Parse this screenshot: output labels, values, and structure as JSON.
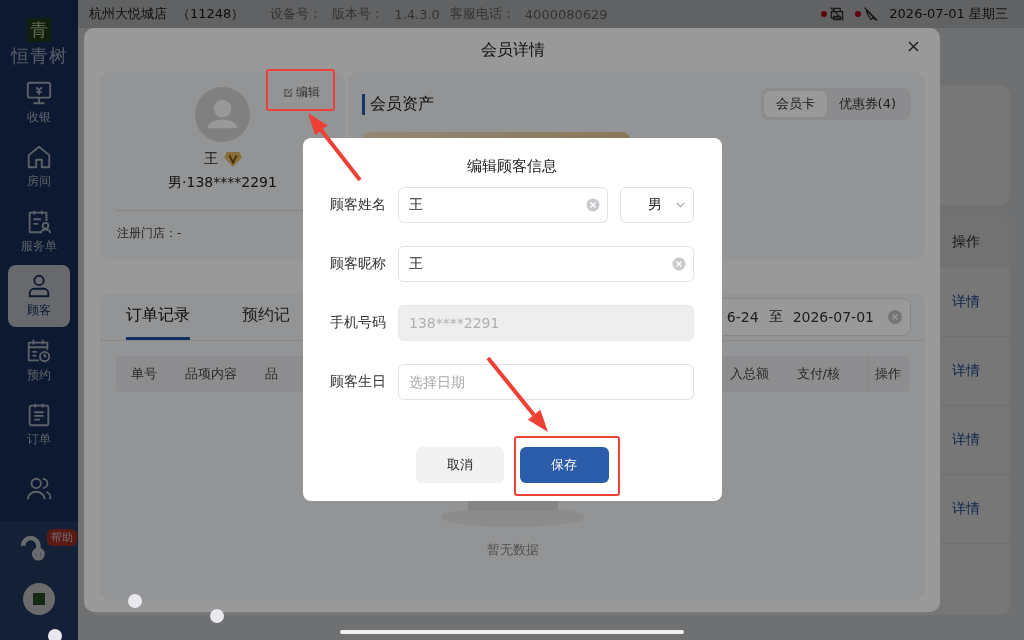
{
  "top_bar": {
    "store_name": "杭州大悦城店",
    "store_code": "（11248）",
    "device_label": "设备号：",
    "version_label": "版本号：",
    "version": "1.4.3.0",
    "service_label": "客服电话：",
    "service_phone": "4000080629",
    "status_icons": [
      {
        "kind": "printer",
        "alert": true
      },
      {
        "kind": "scanner",
        "alert": true
      }
    ],
    "date": "2026-07-01 星期三"
  },
  "sidebar": {
    "logo_mark": "青",
    "logo_text": "恒青树",
    "items": [
      {
        "label": "收银",
        "selected": false
      },
      {
        "label": "房间",
        "selected": false
      },
      {
        "label": "服务单",
        "selected": false
      },
      {
        "label": "顾客",
        "selected": true
      },
      {
        "label": "预约",
        "selected": false
      },
      {
        "label": "订单",
        "selected": false
      },
      {
        "selected": false
      }
    ],
    "help_badge": "帮助"
  },
  "background_list": {
    "header": "操作",
    "rows": [
      "详情",
      "详情",
      "详情",
      "详情"
    ]
  },
  "member_modal": {
    "title": "会员详情",
    "profile": {
      "edit_link": "编辑",
      "name": "王",
      "vip": true,
      "gender_phone": "男·138****2291",
      "store_label": "注册门店：-"
    },
    "assets": {
      "title": "会员资产",
      "tabs": [
        {
          "label": "会员卡",
          "selected": true
        },
        {
          "label": "优惠券(4)",
          "selected": false
        }
      ]
    },
    "records": {
      "tabs": [
        {
          "label": "订单记录",
          "selected": true
        },
        {
          "label": "预约记",
          "selected": false
        }
      ],
      "date_start": "6-24",
      "date_sep": "至",
      "date_end": "2026-07-01",
      "columns_left": [
        "单号",
        "品项内容",
        "品"
      ],
      "columns_right": [
        "入总额",
        "支付/核"
      ],
      "action_column": "操作",
      "empty_text": "暂无数据"
    }
  },
  "edit_dialog": {
    "title": "编辑顾客信息",
    "fields": [
      {
        "kind": "input",
        "label": "顾客姓名",
        "value": "王",
        "disabled": false,
        "select_value": "男"
      },
      {
        "kind": "input",
        "label": "顾客昵称",
        "value": "王",
        "disabled": false
      },
      {
        "kind": "input",
        "label": "手机号码",
        "value": "138****2291",
        "disabled": true
      },
      {
        "kind": "date",
        "label": "顾客生日",
        "placeholder": "选择日期",
        "disabled": false
      }
    ],
    "buttons": [
      {
        "kind": "secondary",
        "label": "取消"
      },
      {
        "kind": "primary",
        "label": "保存"
      }
    ]
  }
}
